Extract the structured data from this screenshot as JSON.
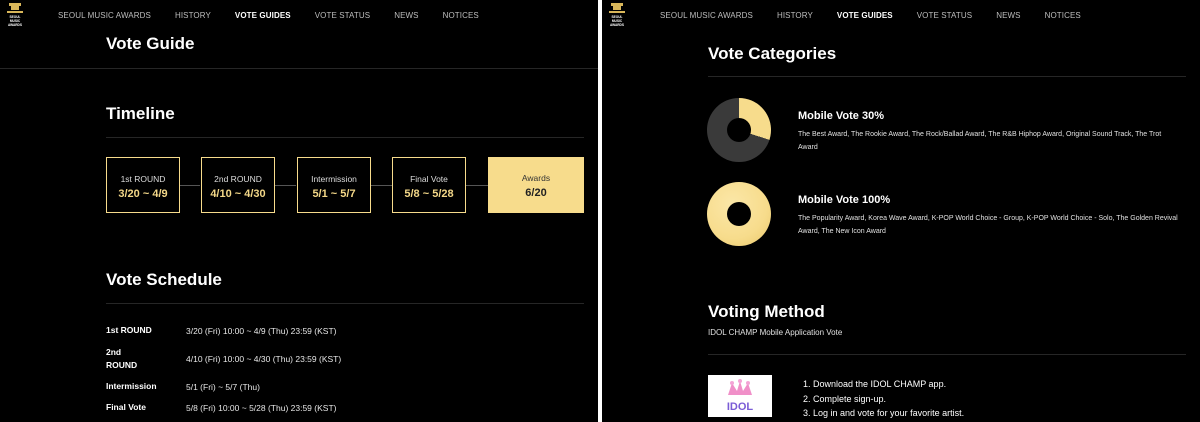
{
  "nav": {
    "logo_text": "SEOUL MUSIC AWARDS",
    "items": [
      "SEOUL MUSIC AWARDS",
      "HISTORY",
      "VOTE GUIDES",
      "VOTE STATUS",
      "NEWS",
      "NOTICES"
    ],
    "active_index": 2
  },
  "left": {
    "vote_guide_title": "Vote Guide",
    "timeline_title": "Timeline",
    "timeline": [
      {
        "title": "1st ROUND",
        "date": "3/20 ~ 4/9"
      },
      {
        "title": "2nd ROUND",
        "date": "4/10 ~ 4/30"
      },
      {
        "title": "Intermission",
        "date": "5/1 ~ 5/7"
      },
      {
        "title": "Final Vote",
        "date": "5/8 ~ 5/28"
      },
      {
        "title": "Awards",
        "date": "6/20"
      }
    ],
    "schedule_title": "Vote Schedule",
    "schedule": [
      {
        "label": "1st ROUND",
        "value": "3/20 (Fri) 10:00 ~ 4/9 (Thu) 23:59 (KST)"
      },
      {
        "label_line1": "2nd",
        "label_line2": "ROUND",
        "value": "4/10 (Fri) 10:00 ~ 4/30 (Thu) 23:59 (KST)"
      },
      {
        "label": "Intermission",
        "value": "5/1 (Fri) ~ 5/7 (Thu)"
      },
      {
        "label": "Final Vote",
        "value": "5/8 (Fri) 10:00 ~ 5/28 (Thu) 23:59 (KST)"
      }
    ]
  },
  "right": {
    "categories_title": "Vote Categories",
    "categories": [
      {
        "title": "Mobile Vote 30%",
        "share": 0.3,
        "desc": "The Best Award, The Rookie Award, The Rock/Ballad Award, The R&B Hiphop Award, Original Sound Track, The Trot Award"
      },
      {
        "title": "Mobile Vote 100%",
        "share": 1.0,
        "desc": "The Popularity Award, Korea Wave Award, K-POP World Choice - Group, K-POP World Choice - Solo, The Golden Revival Award, The New Icon Award"
      }
    ],
    "method_title": "Voting Method",
    "method_sub": "IDOL CHAMP Mobile Application Vote",
    "app_icon_text": "IDOL",
    "steps": [
      "1. Download the IDOL CHAMP app.",
      "2. Complete sign-up.",
      "3. Log in and vote for your favorite artist."
    ]
  },
  "colors": {
    "accent": "#f7dc8c",
    "donut_rest": "#3a3a3a",
    "background": "#000000"
  }
}
